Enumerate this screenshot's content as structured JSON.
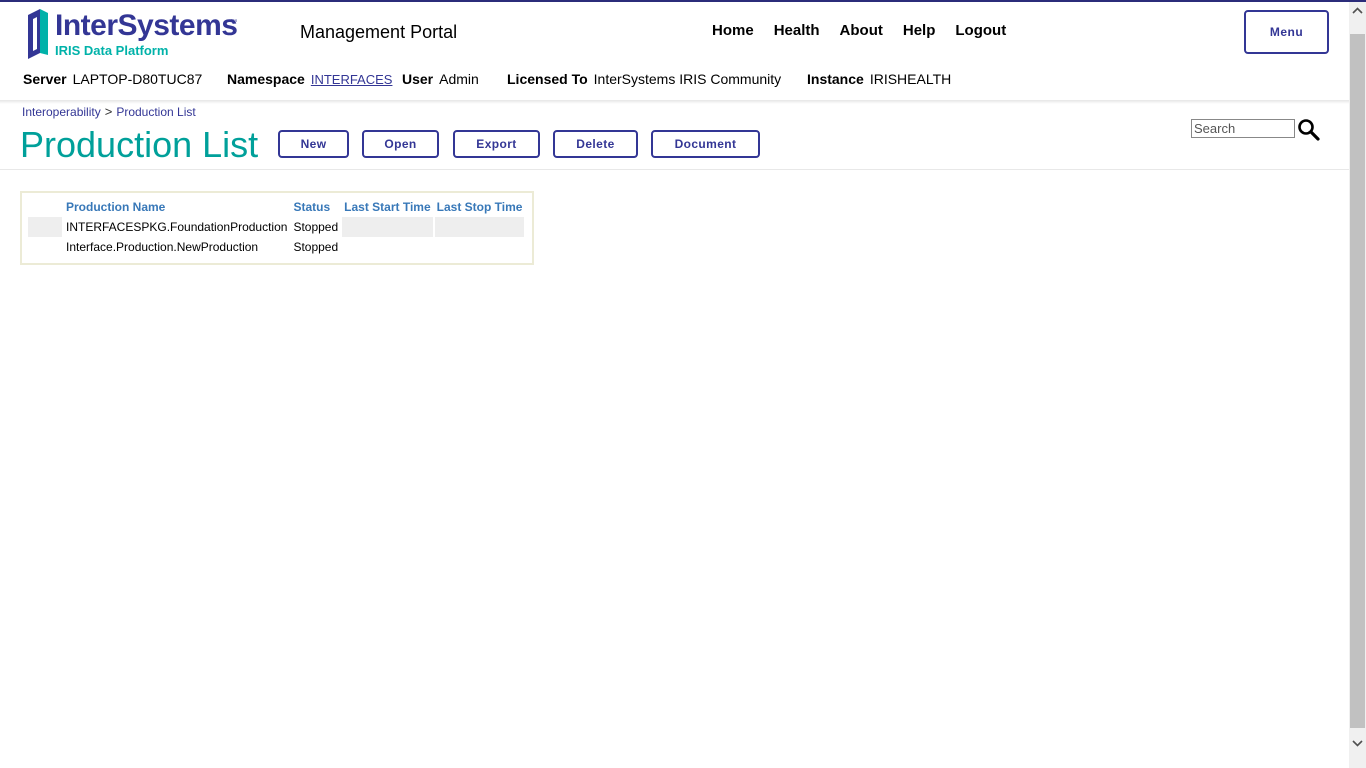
{
  "header": {
    "logo_name": "InterSystems",
    "logo_tm": "™",
    "logo_sub": "IRIS Data Platform",
    "portal_title": "Management Portal",
    "nav": [
      "Home",
      "Health",
      "About",
      "Help",
      "Logout"
    ],
    "menu_label": "Menu"
  },
  "info": {
    "server_label": "Server",
    "server_value": "LAPTOP-D80TUC87",
    "namespace_label": "Namespace",
    "namespace_value": "INTERFACES",
    "user_label": "User",
    "user_value": "Admin",
    "licensed_label": "Licensed To",
    "licensed_value": "InterSystems IRIS Community",
    "instance_label": "Instance",
    "instance_value": "IRISHEALTH"
  },
  "breadcrumb": {
    "items": [
      "Interoperability",
      "Production List"
    ],
    "separator": ">"
  },
  "page_title": "Production List",
  "commands": [
    "New",
    "Open",
    "Export",
    "Delete",
    "Document"
  ],
  "search": {
    "placeholder": "Search",
    "value": ""
  },
  "table": {
    "columns": [
      "Production Name",
      "Status",
      "Last Start Time",
      "Last Stop Time"
    ],
    "rows": [
      [
        "INTERFACESPKG.FoundationProduction",
        "Stopped",
        "",
        ""
      ],
      [
        "Interface.Production.NewProduction",
        "Stopped",
        "",
        ""
      ]
    ]
  },
  "colors": {
    "brand_navy": "#333695",
    "brand_teal": "#00a09a",
    "header_link_blue": "#3878b8"
  }
}
